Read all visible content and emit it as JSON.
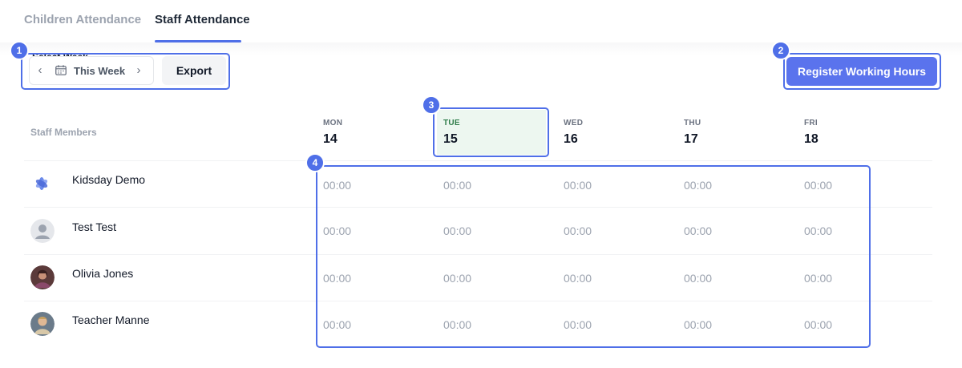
{
  "tabs": [
    {
      "label": "Children Attendance",
      "active": false
    },
    {
      "label": "Staff Attendance",
      "active": true
    }
  ],
  "week_selector": {
    "label": "Select Week",
    "value": "This Week",
    "prev_icon": "chevron-left-icon",
    "next_icon": "chevron-right-icon",
    "calendar_icon": "calendar-icon"
  },
  "export_label": "Export",
  "register_label": "Register Working Hours",
  "table": {
    "staff_header": "Staff Members",
    "days": [
      {
        "name": "MON",
        "date": "14",
        "today": false
      },
      {
        "name": "TUE",
        "date": "15",
        "today": true
      },
      {
        "name": "WED",
        "date": "16",
        "today": false
      },
      {
        "name": "THU",
        "date": "17",
        "today": false
      },
      {
        "name": "FRI",
        "date": "18",
        "today": false
      }
    ],
    "staff": [
      {
        "name": "Kidsday Demo",
        "times": [
          "00:00",
          "00:00",
          "00:00",
          "00:00",
          "00:00"
        ]
      },
      {
        "name": "Test Test",
        "times": [
          "00:00",
          "00:00",
          "00:00",
          "00:00",
          "00:00"
        ]
      },
      {
        "name": "Olivia Jones",
        "times": [
          "00:00",
          "00:00",
          "00:00",
          "00:00",
          "00:00"
        ]
      },
      {
        "name": "Teacher Manne",
        "times": [
          "00:00",
          "00:00",
          "00:00",
          "00:00",
          "00:00"
        ]
      }
    ]
  },
  "annotations": [
    "1",
    "2",
    "3",
    "4"
  ],
  "colors": {
    "accent": "#4f6fe8",
    "primary_button": "#5a73ed",
    "today_background": "#edf7f0",
    "today_text": "#2f7d4a",
    "muted_text": "#9ca3af"
  }
}
